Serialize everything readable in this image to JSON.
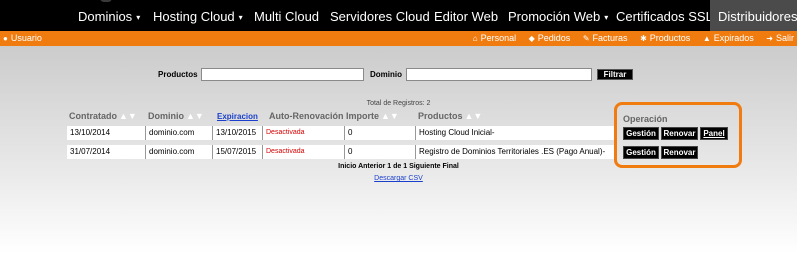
{
  "nav": {
    "items": [
      {
        "label": "Dominios",
        "caret": "▾"
      },
      {
        "label": "Hosting Cloud",
        "caret": "▾"
      },
      {
        "label": "Multi Cloud",
        "caret": ""
      },
      {
        "label": "Servidores Cloud",
        "caret": ""
      },
      {
        "label": "Editor Web",
        "caret": ""
      },
      {
        "label": "Promoción Web",
        "caret": "▾"
      },
      {
        "label": "Certificados SSL",
        "caret": ""
      },
      {
        "label": "Distribuidores",
        "caret": ""
      }
    ],
    "active": "Distribuidores"
  },
  "subbar": {
    "user": "Usuario",
    "links": [
      {
        "label": "Personal",
        "icon": "home-icon"
      },
      {
        "label": "Pedidos",
        "icon": "tag-icon"
      },
      {
        "label": "Facturas",
        "icon": "edit-icon"
      },
      {
        "label": "Productos",
        "icon": "gear-icon"
      },
      {
        "label": "Expirados",
        "icon": "warning-icon"
      },
      {
        "label": "Salir",
        "icon": "exit-icon"
      }
    ]
  },
  "filter": {
    "productos_label": "Productos",
    "productos_value": "",
    "dominio_label": "Dominio",
    "dominio_value": "",
    "button": "Filtrar"
  },
  "table": {
    "total": "Total de Registros: 2",
    "headers": {
      "contratado": "Contratado",
      "dominio": "Dominio",
      "expiracion": "Expiracion",
      "autorenovacion": "Auto-Renovación",
      "importe": "Importe",
      "productos": "Productos",
      "operacion": "Operación"
    },
    "rows": [
      {
        "contratado": "13/10/2014",
        "dominio": "dominio.com",
        "expiracion": "13/10/2015",
        "autorenovacion": "Desactivada",
        "importe": "0",
        "producto": "Hosting Cloud Inicial-",
        "ops": [
          "Gestión",
          "Renovar",
          "Panel"
        ]
      },
      {
        "contratado": "31/07/2014",
        "dominio": "dominio.com",
        "expiracion": "15/07/2015",
        "autorenovacion": "Desactivada",
        "importe": "0",
        "producto": "Registro de Dominios Territoriales .ES (Pago Anual)-",
        "ops": [
          "Gestión",
          "Renovar"
        ]
      }
    ],
    "pager": "Inicio Anterior   1 de 1  Siguiente Final",
    "csv": "Descargar CSV"
  },
  "colors": {
    "accent": "#f07c10",
    "nav_bg": "#000000",
    "link": "#1a3fcc",
    "inactive_red": "#d40000"
  }
}
